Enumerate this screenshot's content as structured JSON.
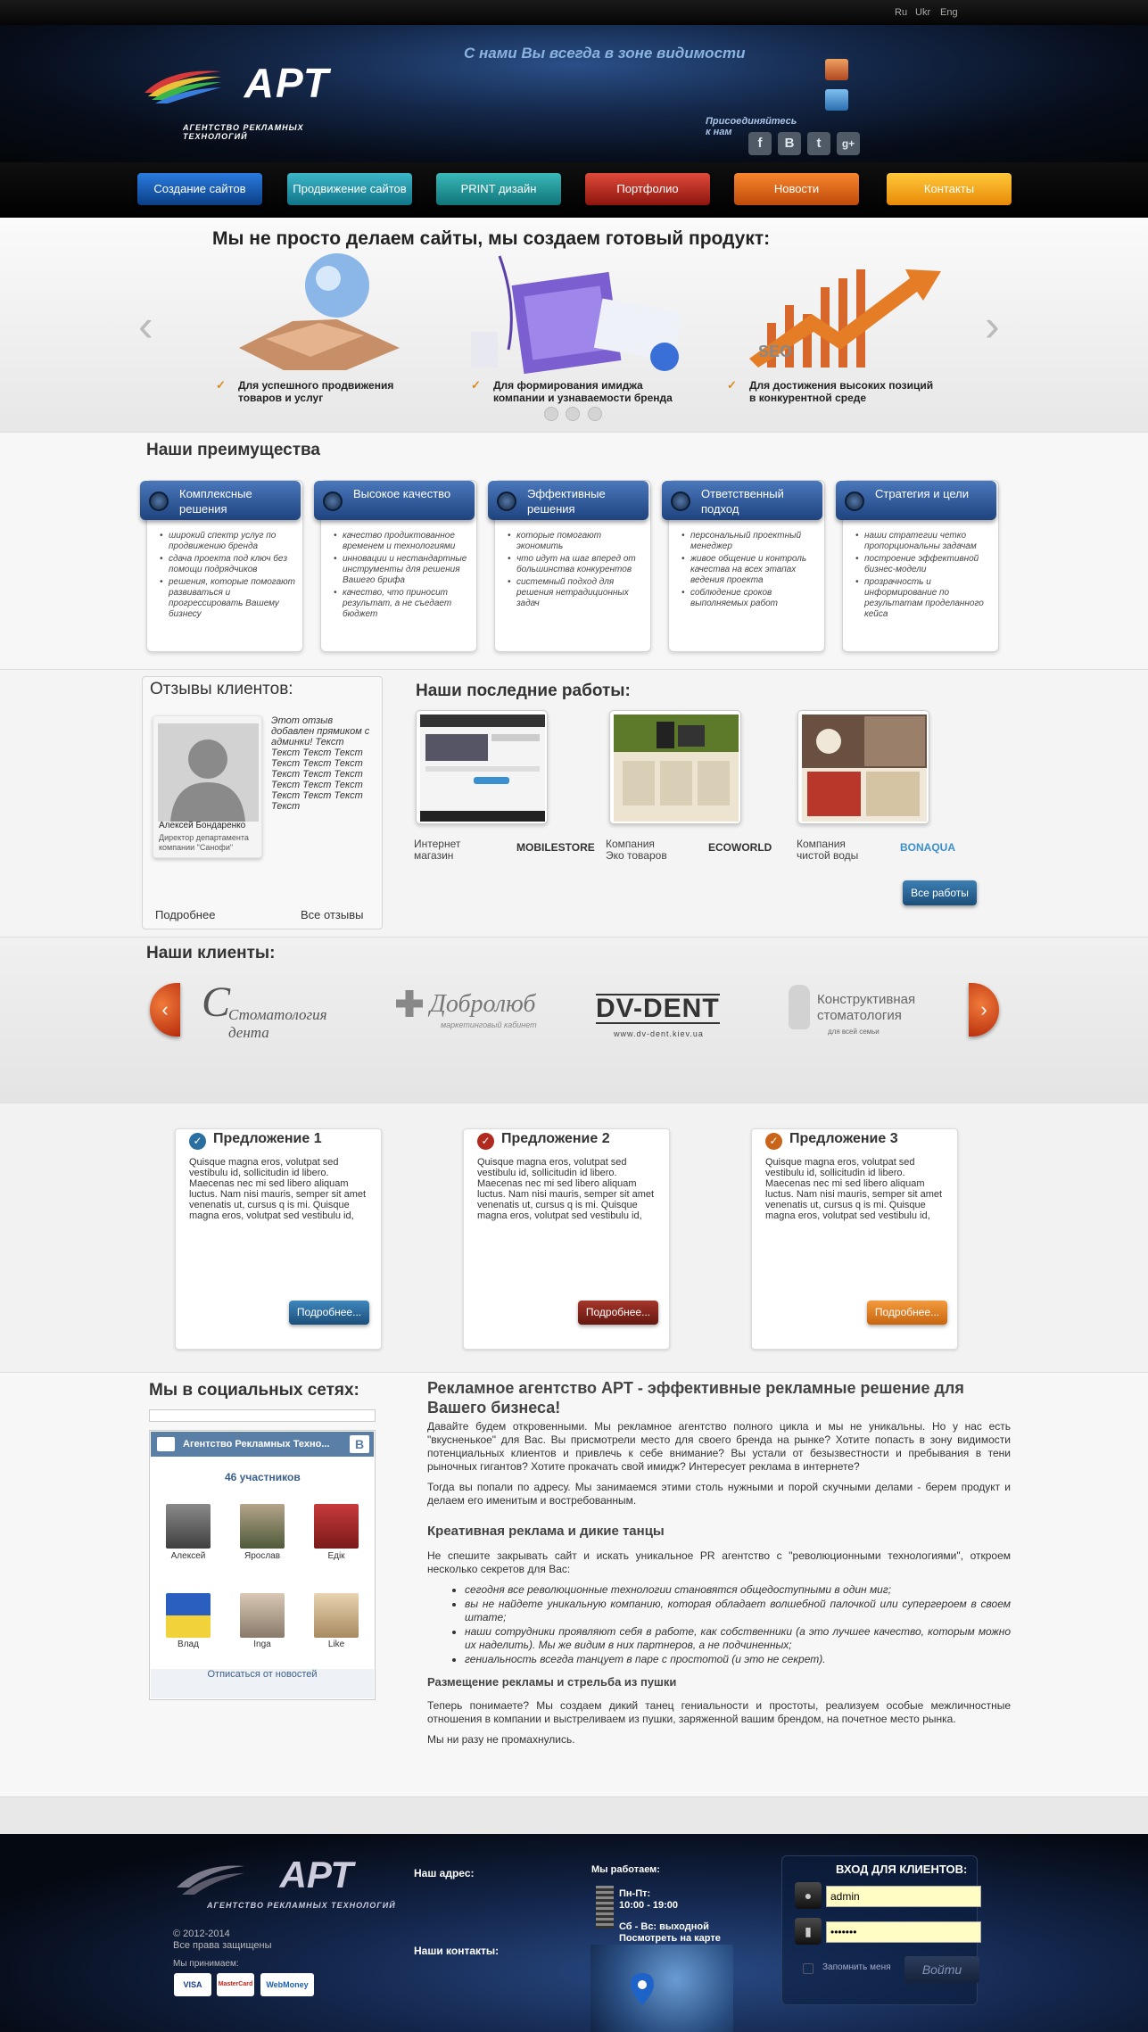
{
  "colors": {
    "accent_blue": "#1b4f7a",
    "nav_blue": "#1457a8",
    "nav_teal": "#1b8fa6",
    "nav_red": "#b5221b",
    "nav_orange": "#e3651a",
    "nav_yellow": "#f0a012"
  },
  "header": {
    "langs": [
      "Ru",
      "Ukr",
      "Eng"
    ],
    "logo": "АРТ",
    "logo_sub": "АГЕНТСТВО РЕКЛАМНЫХ ТЕХНОЛОГИЙ",
    "slogan": "С нами Вы всегда в зоне видимости",
    "join": "Присоединяйтесь к нам",
    "social_icons": [
      "f",
      "B",
      "t",
      "g+"
    ]
  },
  "nav": [
    "Создание сайтов",
    "Продвижение сайтов",
    "PRINT дизайн",
    "Портфолио",
    "Новости",
    "Контакты"
  ],
  "banner": {
    "title": "Мы не просто делаем сайты, мы создаем готовый продукт:",
    "items": [
      {
        "line1": "Для успешного продвижения",
        "line2": "товаров и услуг"
      },
      {
        "line1": "Для формирования имиджа",
        "line2": "компании и узнаваемости бренда"
      },
      {
        "line1": "Для достижения высоких позиций",
        "line2": "в конкурентной среде"
      }
    ]
  },
  "advantages": {
    "title": "Наши преимущества",
    "cards": [
      {
        "title": "Комплексные решения",
        "items": [
          "широкий спектр услуг по продвижению бренда",
          "сдача проекта под ключ без помощи подрядчиков",
          "решения, которые помогают развиваться и прогрессировать Вашему бизнесу"
        ]
      },
      {
        "title": "Высокое качество",
        "items": [
          "качество продиктованное временем и технологиями",
          "инновации и нестандартные инструменты для решения Вашего брифа",
          "качество, что приносит результат, а не съедает бюджет"
        ]
      },
      {
        "title": "Эффективные решения",
        "items": [
          "которые помогают экономить",
          "что идут на шаг вперед от большинства конкурентов",
          "системный подход для решения нетрадиционных задач"
        ]
      },
      {
        "title": "Ответственный подход",
        "items": [
          "персональный проектный менеджер",
          "живое общение и контроль качества на всех этапах ведения проекта",
          "соблюдение сроков выполняемых работ"
        ]
      },
      {
        "title": "Стратегия и цели",
        "items": [
          "наши стратегии четко пропорциональны задачам",
          "построение эффективной бизнес-модели",
          "прозрачность и информирование по результатам проделанного кейса"
        ]
      }
    ]
  },
  "reviews": {
    "title": "Отзывы клиентов:",
    "name": "Алексей Бондаренко",
    "position": "Директор департамента компании \"Санофи\"",
    "text": "Этот отзыв добавлен прямиком с админки! Текст Текст Текст Текст Текст Текст Текст Текст Текст Текст Текст Текст Текст Текст Текст Текст Текст",
    "more": "Подробнее",
    "all": "Все отзывы"
  },
  "works": {
    "title": "Наши последние работы:",
    "items": [
      {
        "desc": "Интернет магазин",
        "name": "MOBILESTORE"
      },
      {
        "desc": "Компания Эко товаров",
        "name": "ECOWORLD"
      },
      {
        "desc": "Компания чистой воды",
        "name": "BONAQUA"
      }
    ],
    "all_button": "Все работы"
  },
  "clients": {
    "title": "Наши клиенты:",
    "logos": [
      "Стоматология дента",
      "Добролюб",
      "DV-DENT",
      "Конструктивная стоматология"
    ],
    "logo_subs": [
      "",
      "маркетинговый кабинет",
      "www.dv-dent.kiev.ua",
      "для всей семьи"
    ]
  },
  "offers": [
    {
      "title": "Предложение 1",
      "text": "Quisque magna eros, volutpat sed vestibulu id, sollicitudin id libero. Maecenas nec mi sed libero aliquam luctus. Nam nisi mauris, semper sit amet venenatis ut, cursus q is mi. Quisque magna eros, volutpat sed vestibulu id,",
      "button": "Подробнее...",
      "color": "#2a6fa0"
    },
    {
      "title": "Предложение 2",
      "text": "Quisque magna eros, volutpat sed vestibulu id, sollicitudin id libero. Maecenas nec mi sed libero aliquam luctus. Nam nisi mauris, semper sit amet venenatis ut, cursus q is mi. Quisque magna eros, volutpat sed vestibulu id,",
      "button": "Подробнее...",
      "color": "#8a241b"
    },
    {
      "title": "Предложение 3",
      "text": "Quisque magna eros, volutpat sed vestibulu id, sollicitudin id libero. Maecenas nec mi sed libero aliquam luctus. Nam nisi mauris, semper sit amet venenatis ut, cursus q is mi. Quisque magna eros, volutpat sed vestibulu id,",
      "button": "Подробнее...",
      "color": "#e07e20"
    }
  ],
  "social": {
    "title": "Мы в социальных сетях:",
    "group": "Агентство Рекламных Техно...",
    "count": "46 участников",
    "members": [
      "Алексей",
      "Ярослав",
      "Едік",
      "Влад",
      "Inga",
      "Like"
    ],
    "unsubscribe": "Отписаться от новостей"
  },
  "article": {
    "title": "Рекламное агентство АРТ - эффективные рекламные решение для Вашего бизнеса!",
    "p1": "Давайте будем откровенными. Мы рекламное агентство полного цикла и мы не уникальны. Но у нас есть \"вкусненькое\" для Вас. Вы присмотрели место для своего бренда на рынке? Хотите попасть в зону видимости потенциальных клиентов и привлечь к себе внимание? Вы устали от безызвестности и пребывания в тени рыночных гигантов? Хотите прокачать свой имидж? Интересует реклама в интернете?",
    "p2": "Тогда вы попали по адресу. Мы занимаемся этими столь нужными и порой скучными делами - берем продукт и делаем его именитым и востребованным.",
    "h2": "Креативная реклама и дикие танцы",
    "p3": "Не спешите закрывать сайт и искать уникальное PR агентство с \"революционными технологиями\", откроем несколько секретов для Вас:",
    "list": [
      "сегодня все революционные технологии становятся общедоступными в один миг;",
      "вы не найдете уникальную компанию, которая обладает волшебной палочкой или супергероем в своем штате;",
      " наши сотрудники проявляют себя в работе, как собственники (а это лучшее качество, которым можно их наделить). Мы же видим в них партнеров, а не подчиненных;",
      "гениальность всегда танцует в паре с простотой (и это не секрет)."
    ],
    "h3": "Размещение рекламы и стрельба из пушки",
    "p4": "Теперь понимаете? Мы создаем дикий танец гениальности и простоты, реализуем особые межличностные отношения в компании и выстреливаем из пушки, заряженной вашим брендом, на почетное место рынка.",
    "p5": "Мы ни разу не промахнулись."
  },
  "footer": {
    "logo": "АРТ",
    "logo_sub": "АГЕНТСТВО РЕКЛАМНЫХ ТЕХНОЛОГИЙ",
    "copyright": "© 2012-2014",
    "rights": "Все права защищены",
    "accept": "Мы принимаем:",
    "payments": [
      "VISA",
      "MasterCard",
      "WebMoney"
    ],
    "address_label": "Наш адрес:",
    "contacts_label": "Наши контакты:",
    "work_label": "Мы работаем:",
    "weekdays": "Пн-Пт:",
    "weekdays_time": "10:00 - 19:00",
    "weekend": "Сб - Вс: выходной",
    "map_label": "Посмотреть на карте"
  },
  "login": {
    "title": "ВХОД ДЛЯ КЛИЕНТОВ:",
    "username": "admin",
    "password": "•••••••",
    "remember": "Запомнить меня",
    "button": "Войти"
  }
}
